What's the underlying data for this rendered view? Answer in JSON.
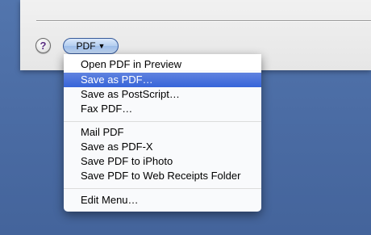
{
  "dialog": {
    "help_label": "?",
    "pdf_button": {
      "label": "PDF",
      "arrow": "▼"
    }
  },
  "menu": {
    "items": [
      {
        "label": "Open PDF in Preview"
      },
      {
        "label": "Save as PDF…",
        "highlighted": true
      },
      {
        "label": "Save as PostScript…"
      },
      {
        "label": "Fax PDF…"
      },
      {
        "label": "Mail PDF"
      },
      {
        "label": "Save as PDF-X"
      },
      {
        "label": "Save PDF to iPhoto"
      },
      {
        "label": "Save PDF to Web Receipts Folder"
      },
      {
        "label": "Edit Menu…"
      }
    ]
  },
  "colors": {
    "desktop": "#4d6fa6",
    "highlight": "#3765d9",
    "button_border": "#375a9a"
  }
}
